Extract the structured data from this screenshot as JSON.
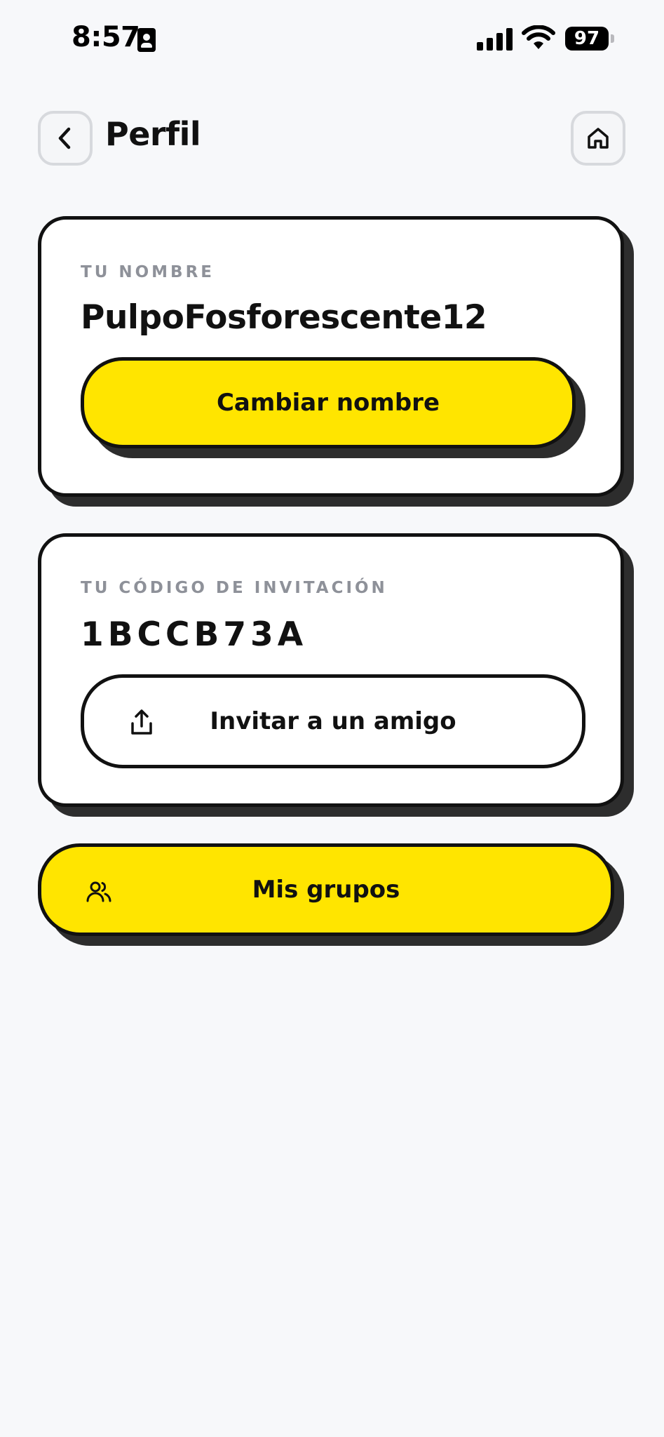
{
  "status_bar": {
    "time": "8:57",
    "battery": "97"
  },
  "header": {
    "title": "Perfil",
    "back_icon": "chevron-left-icon",
    "home_icon": "home-icon"
  },
  "name_card": {
    "label": "TU NOMBRE",
    "value": "PulpoFosforescente12",
    "button_label": "Cambiar nombre"
  },
  "invite_card": {
    "label": "TU CÓDIGO DE INVITACIÓN",
    "code": "1BCCB73A",
    "button_label": "Invitar a un amigo",
    "button_icon": "share-icon"
  },
  "groups_button": {
    "label": "Mis grupos",
    "icon": "users-icon"
  },
  "colors": {
    "accent": "#ffe500",
    "background": "#f7f8fa",
    "border": "#111111",
    "muted_label": "#8e9199"
  }
}
